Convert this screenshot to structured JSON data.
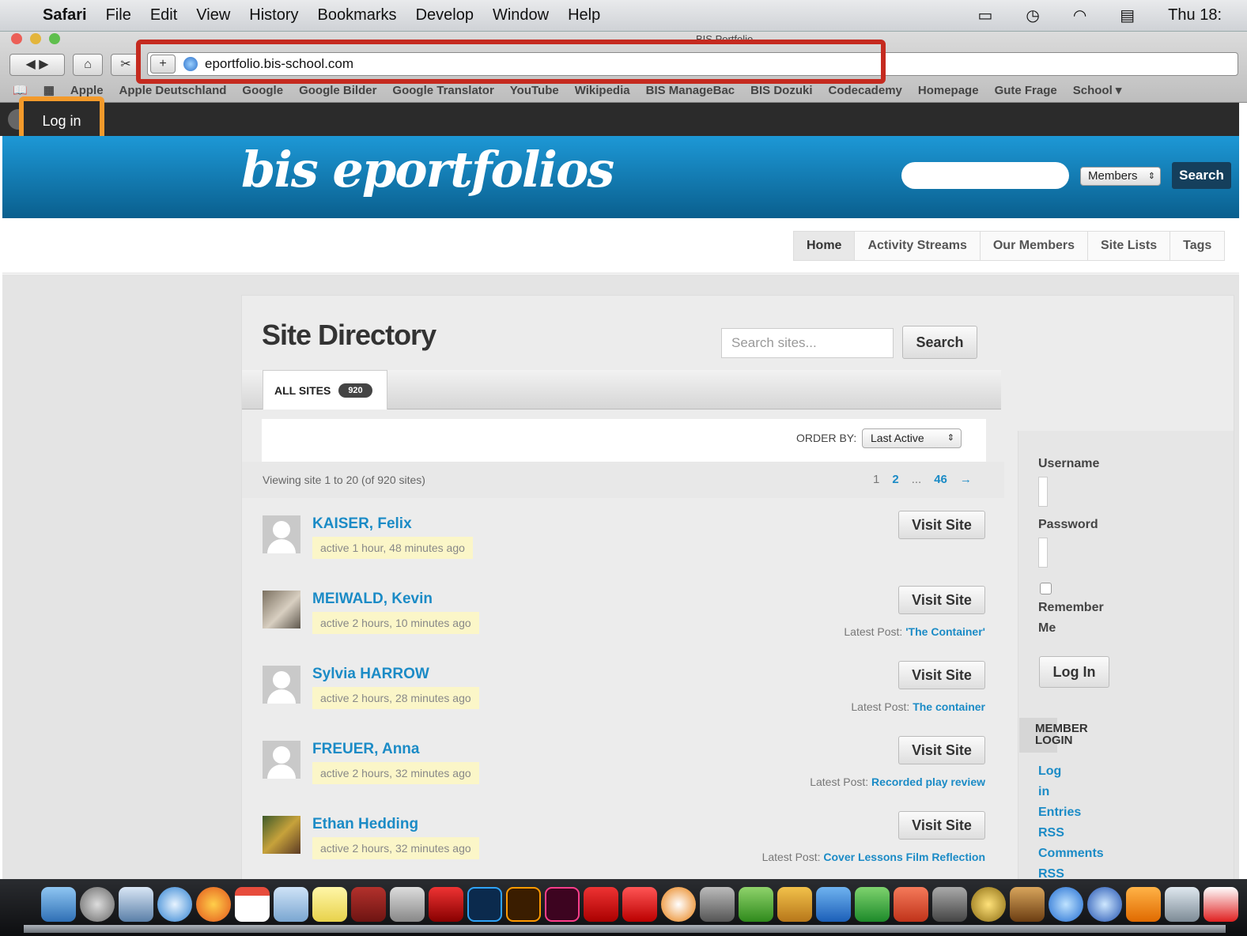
{
  "menubar": {
    "app": "Safari",
    "items": [
      "File",
      "Edit",
      "View",
      "History",
      "Bookmarks",
      "Develop",
      "Window",
      "Help"
    ],
    "clock": "Thu 18:"
  },
  "browser": {
    "window_title": "BIS Portfolio",
    "url": "eportfolio.bis-school.com",
    "bookmarks": [
      "Apple",
      "Apple Deutschland",
      "Google",
      "Google Bilder",
      "Google Translator",
      "YouTube",
      "Wikipedia",
      "BIS ManageBac",
      "BIS Dozuki",
      "Codecademy",
      "Homepage",
      "Gute Frage",
      "School ▾"
    ]
  },
  "adminbar": {
    "login": "Log in"
  },
  "site": {
    "logo": "bis eportfolios",
    "header_select": "Members",
    "header_search_btn": "Search",
    "nav": [
      "Home",
      "Activity Streams",
      "Our Members",
      "Site Lists",
      "Tags"
    ]
  },
  "directory": {
    "title": "Site Directory",
    "search_placeholder": "Search sites...",
    "search_btn": "Search",
    "tab_label": "ALL SITES",
    "tab_count": "920",
    "order_label": "ORDER BY:",
    "order_value": "Last Active",
    "viewing": "Viewing site 1 to 20 (of 920 sites)",
    "pages": [
      "1",
      "2",
      "...",
      "46",
      "→"
    ],
    "visit_label": "Visit Site",
    "latest_label": "Latest Post:",
    "rows": [
      {
        "name": "KAISER, Felix",
        "active": "active 1 hour, 48 minutes ago",
        "latest": ""
      },
      {
        "name": "MEIWALD, Kevin",
        "active": "active 2 hours, 10 minutes ago",
        "latest": "'The Container'"
      },
      {
        "name": "Sylvia HARROW",
        "active": "active 2 hours, 28 minutes ago",
        "latest": "The container"
      },
      {
        "name": "FREUER, Anna",
        "active": "active 2 hours, 32 minutes ago",
        "latest": "Recorded play review"
      },
      {
        "name": "Ethan Hedding",
        "active": "active 2 hours, 32 minutes ago",
        "latest": "Cover Lessons Film Reflection"
      }
    ]
  },
  "sidebar": {
    "username": "Username",
    "password": "Password",
    "remember1": "Remember",
    "remember2": "Me",
    "login_btn": "Log In",
    "member_login": "MEMBER LOGIN",
    "links": [
      "Log",
      "in",
      "Entries",
      "RSS",
      "Comments",
      "RSS"
    ]
  },
  "colors": {
    "accent": "#1b8bc6",
    "header": "#0a6fa6",
    "highlight_url": "#c52a1f",
    "highlight_login": "#f39a2b"
  }
}
